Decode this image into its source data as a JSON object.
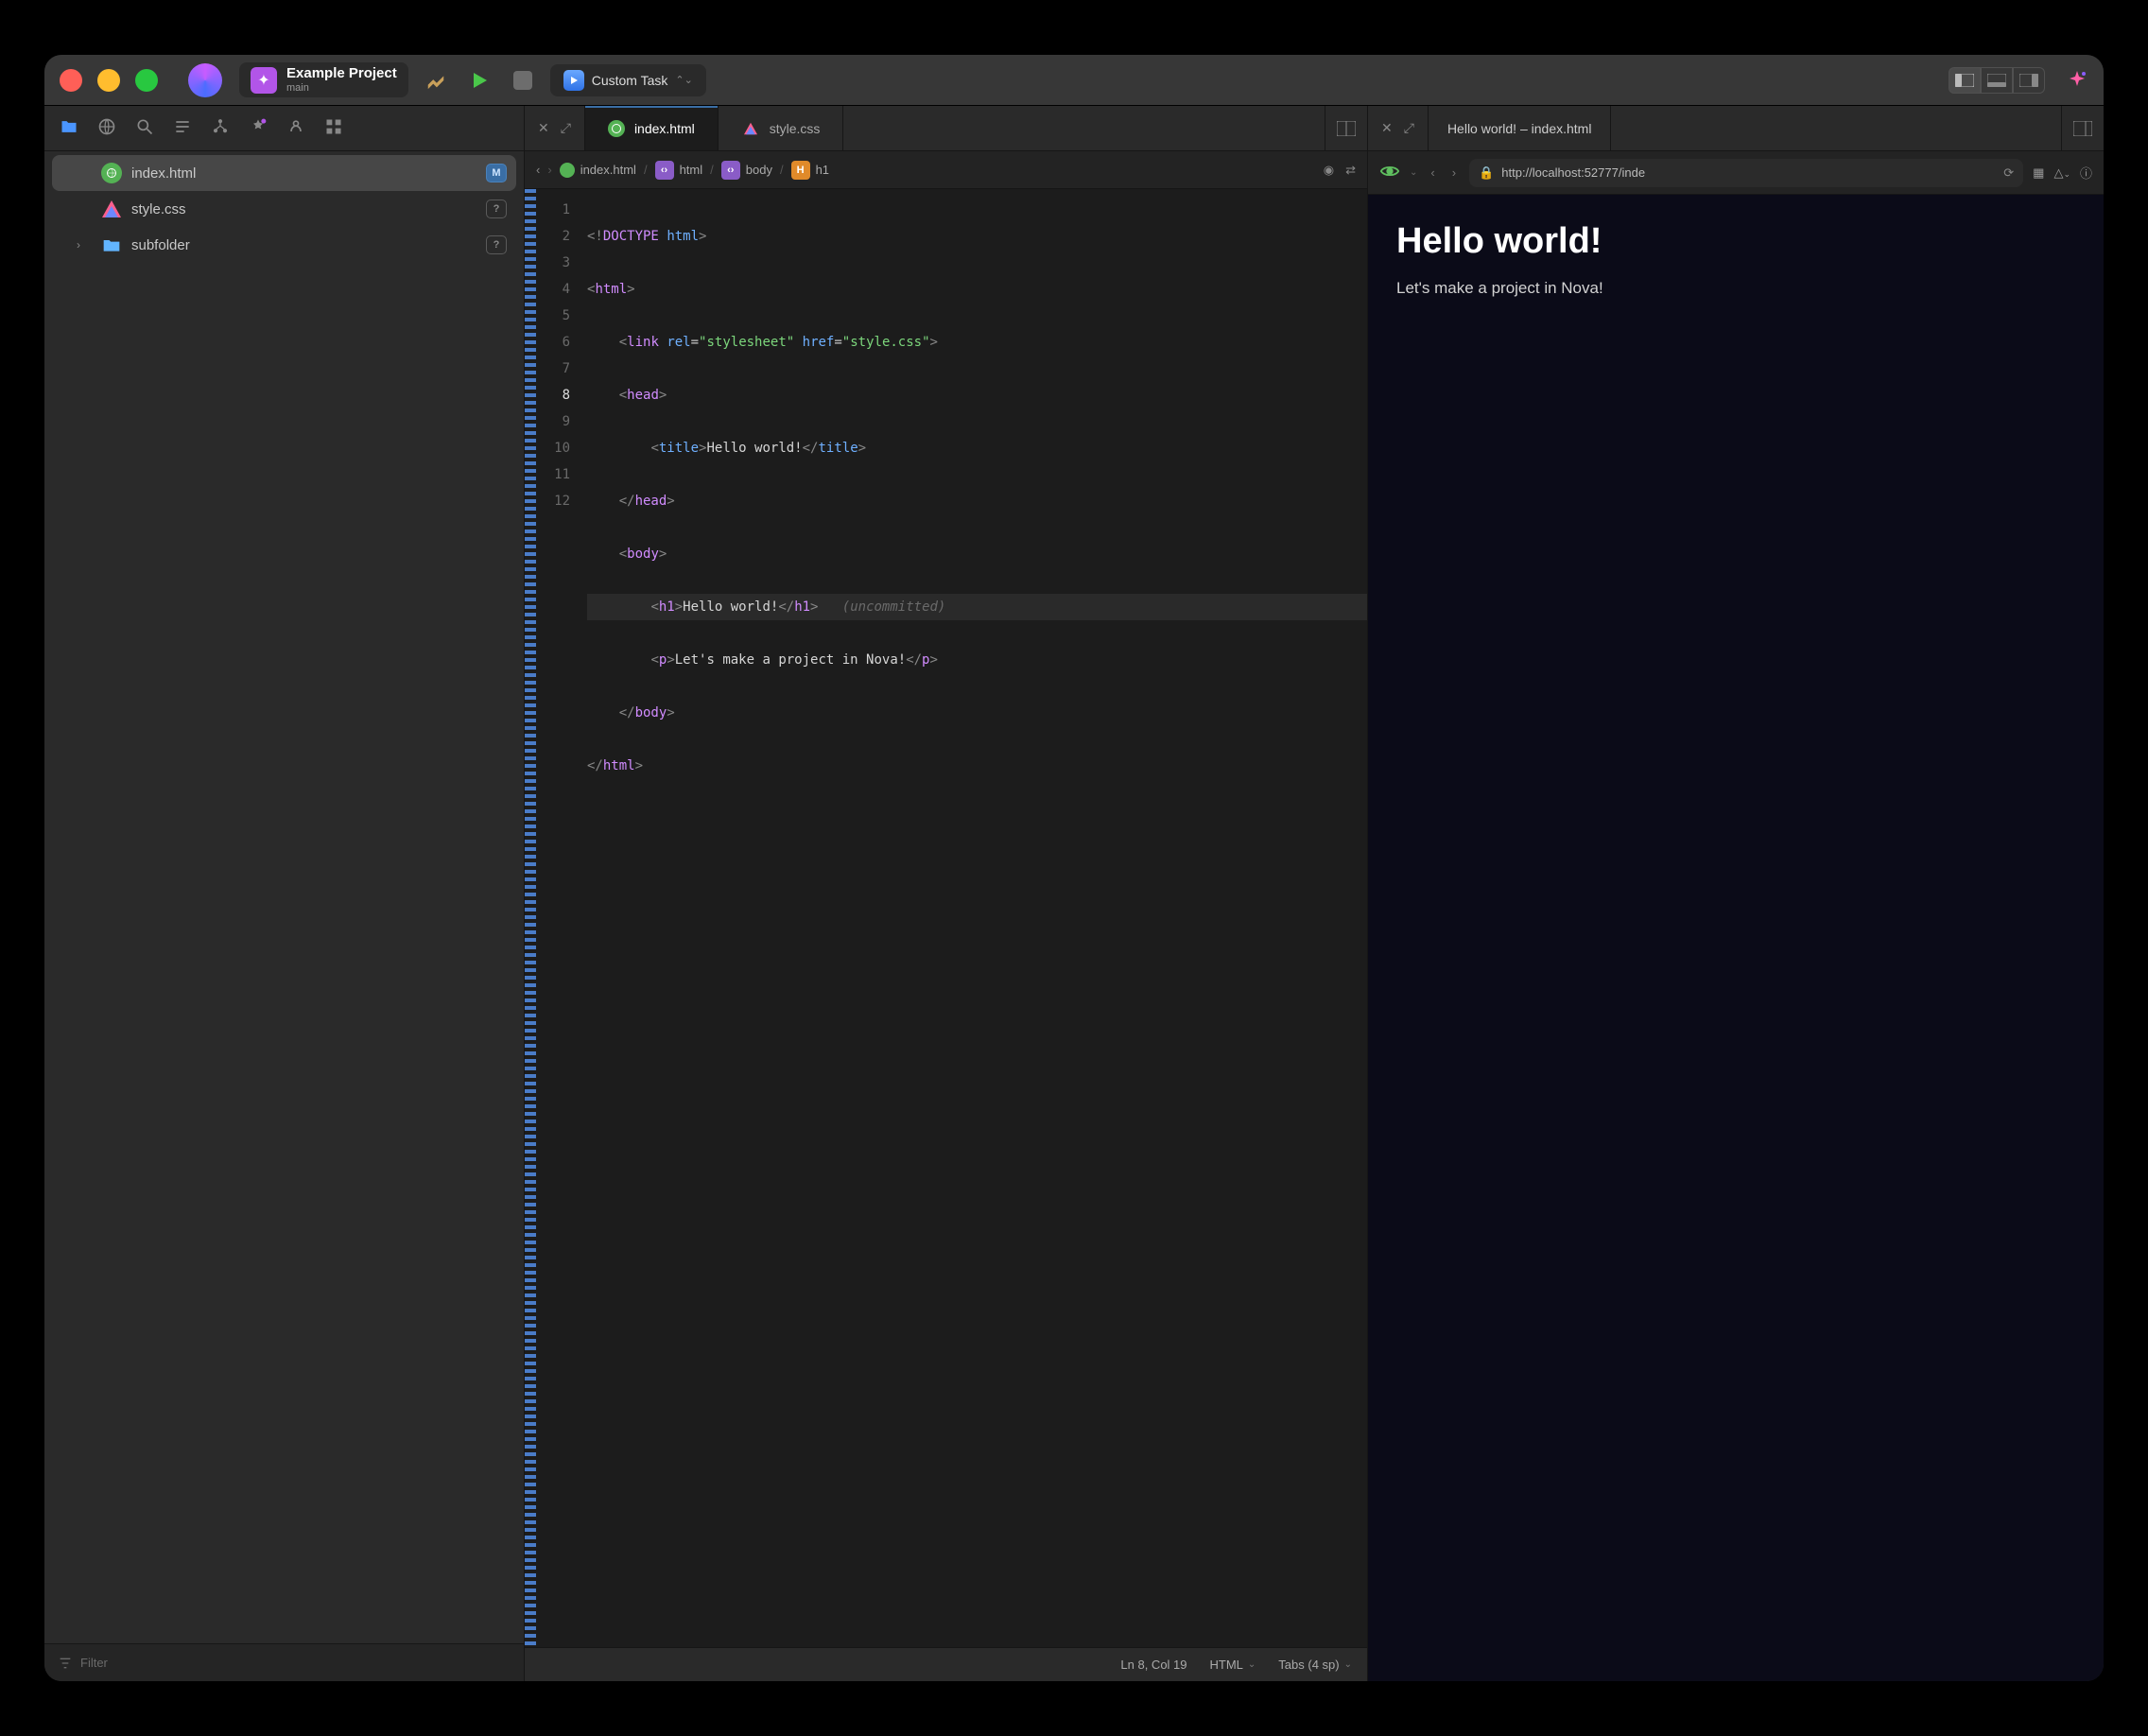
{
  "project": {
    "name": "Example Project",
    "branch": "main"
  },
  "task": {
    "label": "Custom Task"
  },
  "sidebar": {
    "files": [
      {
        "name": "index.html",
        "badge": "M",
        "kind": "html"
      },
      {
        "name": "style.css",
        "badge": "?",
        "kind": "css"
      },
      {
        "name": "subfolder",
        "badge": "?",
        "kind": "folder"
      }
    ],
    "filter_placeholder": "Filter"
  },
  "tabs": [
    {
      "name": "index.html",
      "active": true,
      "kind": "html"
    },
    {
      "name": "style.css",
      "active": false,
      "kind": "css"
    }
  ],
  "breadcrumb": [
    "index.html",
    "html",
    "body",
    "h1"
  ],
  "code": {
    "lines": [
      "<!DOCTYPE html>",
      "<html>",
      "    <link rel=\"stylesheet\" href=\"style.css\">",
      "    <head>",
      "        <title>Hello world!</title>",
      "    </head>",
      "    <body>",
      "        <h1>Hello world!</h1>",
      "        <p>Let's make a project in Nova!</p>",
      "    </body>",
      "</html>",
      ""
    ],
    "current_line": 8,
    "annotation": "(uncommitted)"
  },
  "status": {
    "position": "Ln 8, Col 19",
    "language": "HTML",
    "indent": "Tabs (4 sp)"
  },
  "preview": {
    "tab_title": "Hello world! – index.html",
    "url": "http://localhost:52777/inde",
    "heading": "Hello world!",
    "paragraph": "Let's make a project in Nova!"
  }
}
